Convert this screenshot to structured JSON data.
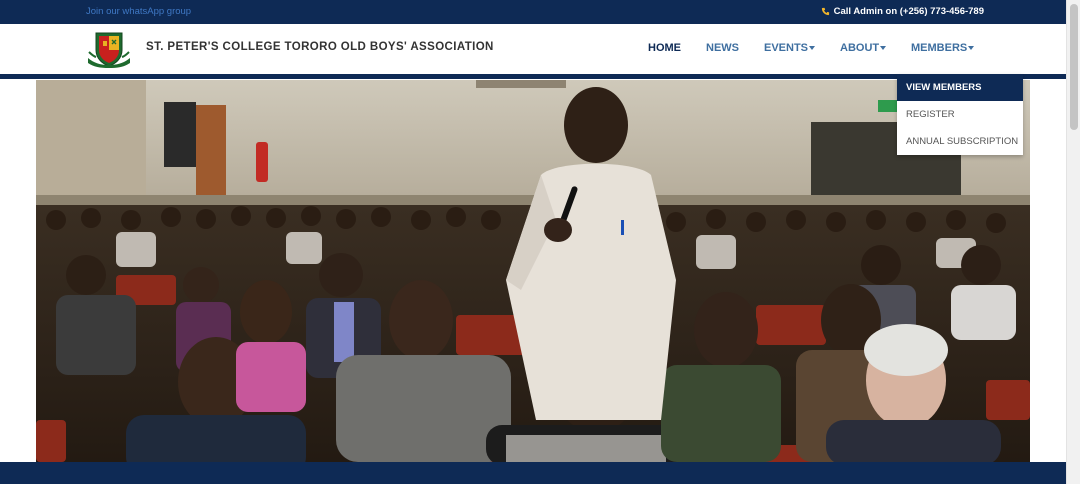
{
  "topbar": {
    "left_link": "Join our whatsApp group",
    "right_info": "Call Admin on (+256) 773-456-789",
    "phone_icon": "phone-icon"
  },
  "header": {
    "title": "ST. PETER'S COLLEGE TORORO OLD BOYS' ASSOCIATION",
    "logo_icon": "school-crest-logo"
  },
  "nav": {
    "items": [
      {
        "label": "HOME"
      },
      {
        "label": "NEWS"
      },
      {
        "label": "EVENTS"
      },
      {
        "label": "ABOUT"
      },
      {
        "label": "MEMBERS"
      }
    ]
  },
  "dropdown": {
    "items": [
      {
        "label": "VIEW MEMBERS"
      },
      {
        "label": "REGISTER"
      },
      {
        "label": "ANNUAL SUBSCRIPTION"
      }
    ]
  },
  "colors": {
    "primary_navy": "#0e2a55",
    "nav_link": "#3f6fa0",
    "link_blue": "#3f78c4"
  }
}
